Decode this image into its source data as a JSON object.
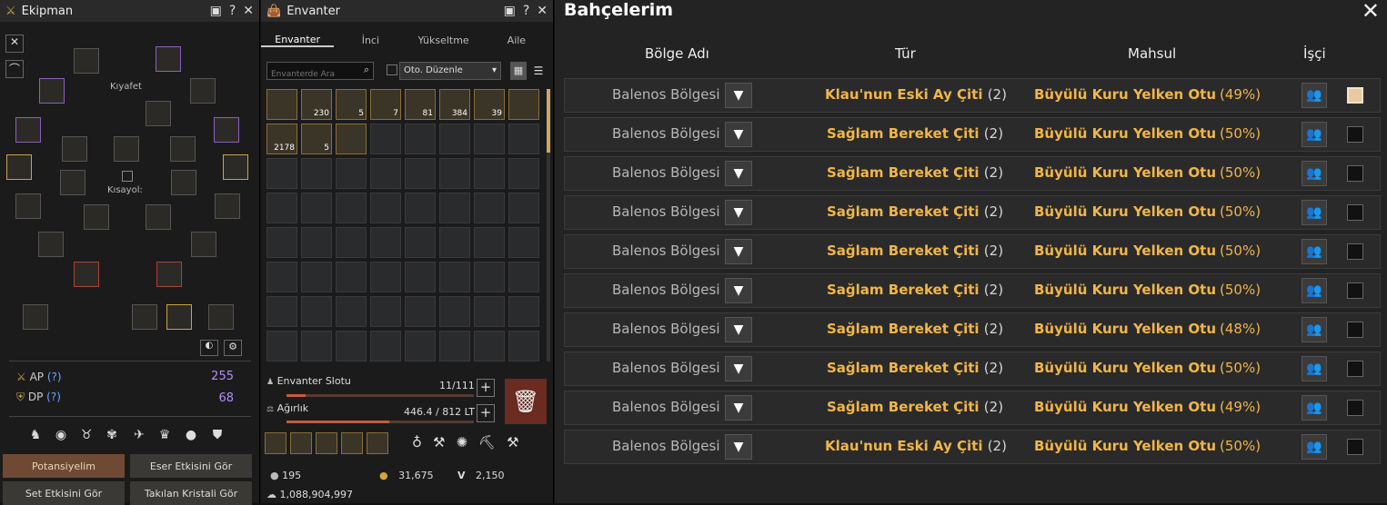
{
  "equipment": {
    "title": "Ekipman",
    "outfit_label": "Kıyafet",
    "shortcut_label": "Kısayol:",
    "ap_label": "AP",
    "ap_help": "(?)",
    "ap_value": "255",
    "dp_label": "DP",
    "dp_help": "(?)",
    "dp_value": "68",
    "btn_potential": "Potansiyelim",
    "btn_artifact": "Eser Etkisini Gör",
    "btn_set": "Set Etkisini Gör",
    "btn_crystal": "Takılan Kristali Gör"
  },
  "inventory": {
    "title": "Envanter",
    "tabs": [
      "Envanter",
      "İnci",
      "Yükseltme",
      "Aile"
    ],
    "search_placeholder": "Envanterde Ara",
    "auto_sort": "Oto. Düzenle",
    "item_counts": [
      "",
      "230",
      "5",
      "7",
      "81",
      "384",
      "39",
      "",
      "2178",
      "5",
      ""
    ],
    "slot_label": "Envanter Slotu",
    "slot_value": "11/111",
    "slot_fill": 0.1,
    "weight_label": "Ağırlık",
    "weight_value": "446.4 / 812 LT",
    "weight_fill": 0.55,
    "silver_small": "195",
    "gold_value": "31,675",
    "v_label": "V",
    "v_value": "2,150",
    "silver_total": "1,088,904,997"
  },
  "gardens": {
    "title": "Bahçelerim",
    "columns": {
      "region": "Bölge Adı",
      "type": "Tür",
      "crop": "Mahsul",
      "worker": "İşçi"
    },
    "rows": [
      {
        "region": "Balenos Bölgesi",
        "type": "Klau'nun Eski Ay Çiti",
        "count": "(2)",
        "crop": "Büyülü Kuru Yelken Otu",
        "pct": "(49%)",
        "checked": true
      },
      {
        "region": "Balenos Bölgesi",
        "type": "Sağlam Bereket Çiti",
        "count": "(2)",
        "crop": "Büyülü Kuru Yelken Otu",
        "pct": "(50%)",
        "checked": false
      },
      {
        "region": "Balenos Bölgesi",
        "type": "Sağlam Bereket Çiti",
        "count": "(2)",
        "crop": "Büyülü Kuru Yelken Otu",
        "pct": "(50%)",
        "checked": false
      },
      {
        "region": "Balenos Bölgesi",
        "type": "Sağlam Bereket Çiti",
        "count": "(2)",
        "crop": "Büyülü Kuru Yelken Otu",
        "pct": "(50%)",
        "checked": false
      },
      {
        "region": "Balenos Bölgesi",
        "type": "Sağlam Bereket Çiti",
        "count": "(2)",
        "crop": "Büyülü Kuru Yelken Otu",
        "pct": "(50%)",
        "checked": false
      },
      {
        "region": "Balenos Bölgesi",
        "type": "Sağlam Bereket Çiti",
        "count": "(2)",
        "crop": "Büyülü Kuru Yelken Otu",
        "pct": "(50%)",
        "checked": false
      },
      {
        "region": "Balenos Bölgesi",
        "type": "Sağlam Bereket Çiti",
        "count": "(2)",
        "crop": "Büyülü Kuru Yelken Otu",
        "pct": "(48%)",
        "checked": false
      },
      {
        "region": "Balenos Bölgesi",
        "type": "Sağlam Bereket Çiti",
        "count": "(2)",
        "crop": "Büyülü Kuru Yelken Otu",
        "pct": "(50%)",
        "checked": false
      },
      {
        "region": "Balenos Bölgesi",
        "type": "Sağlam Bereket Çiti",
        "count": "(2)",
        "crop": "Büyülü Kuru Yelken Otu",
        "pct": "(49%)",
        "checked": false
      },
      {
        "region": "Balenos Bölgesi",
        "type": "Klau'nun Eski Ay Çiti",
        "count": "(2)",
        "crop": "Büyülü Kuru Yelken Otu",
        "pct": "(50%)",
        "checked": false
      }
    ]
  }
}
